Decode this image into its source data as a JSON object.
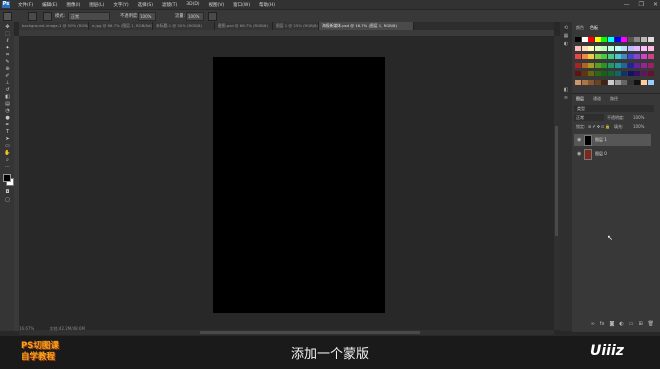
{
  "menubar": {
    "app_logo": "Ps",
    "items": [
      "文件(F)",
      "编辑(E)",
      "图像(I)",
      "图层(L)",
      "文字(Y)",
      "选择(S)",
      "滤镜(T)",
      "3D(D)",
      "视图(V)",
      "窗口(W)",
      "帮助(H)"
    ]
  },
  "window_controls": {
    "minimize": "—",
    "restore": "❐",
    "close": "✕"
  },
  "options": {
    "mode_label": "模式:",
    "mode_value": "正常",
    "opacity_label": "不透明度:",
    "opacity_value": "100%",
    "flow_label": "流量:",
    "flow_value": "100%"
  },
  "tabs": [
    {
      "label": "background-image-1 @ 50% (RGB/8)",
      "active": false
    },
    {
      "label": "a.jpg @ 66.7% (图层 1, RGB/8#)",
      "active": false
    },
    {
      "label": "未标题-1 @ 50% (RGB/8)",
      "active": false
    },
    {
      "label": "截图.psd @ 66.7% (RGB/8)",
      "active": false
    },
    {
      "label": "图层 1 @ 25% (RGB/8)",
      "active": false
    },
    {
      "label": "海报新媒体.psd @ 16.7% (图层 1, RGB/8)",
      "active": true
    }
  ],
  "status": {
    "zoom": "16.67%",
    "doc_info": "文档:42.2M/48.6M"
  },
  "panels": {
    "color_tab": "颜色",
    "swatches_tab": "色板",
    "layers_tab": "图层",
    "channels_tab": "通道",
    "paths_tab": "路径",
    "filter_label": "类型",
    "blend_mode": "正常",
    "opacity_label": "不透明度:",
    "opacity_value": "100%",
    "lock_label": "锁定:",
    "fill_label": "填充:",
    "fill_value": "100%"
  },
  "layers": [
    {
      "name": "图层 1",
      "selected": true,
      "thumb_color": "#000000"
    },
    {
      "name": "图层 0",
      "selected": false,
      "thumb_color": "#7a2a1a"
    }
  ],
  "caption": "添加一个蒙版",
  "brand_left": {
    "line1": "PS切图课",
    "line2": "自学教程"
  },
  "brand_right": "Uiiiz",
  "colors": {
    "accent_blue": "#2c6fb7",
    "brand_orange": "#f7a61a",
    "workspace": "#282828",
    "document": "#000000"
  }
}
